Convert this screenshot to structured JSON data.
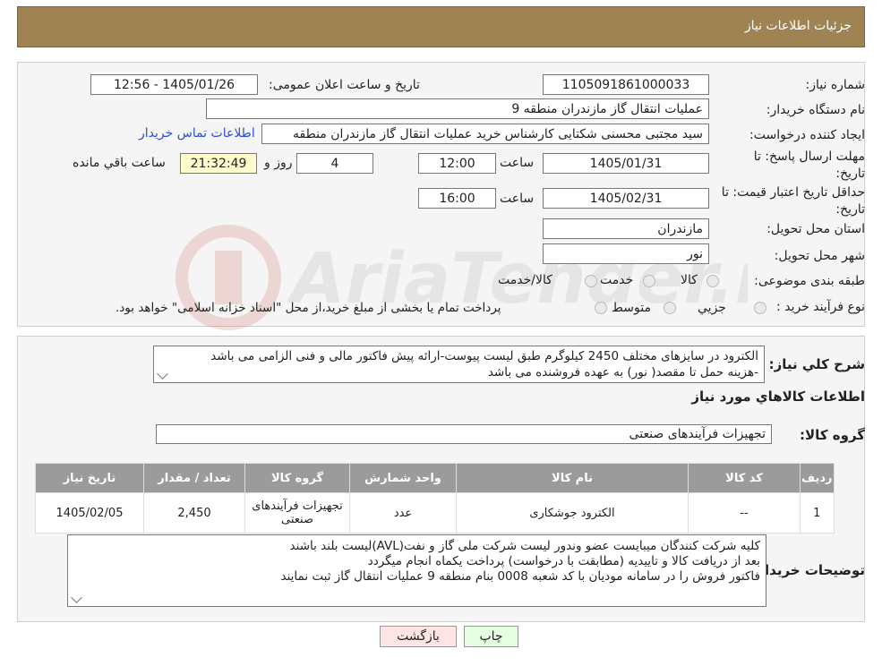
{
  "header": {
    "title": "جزئیات اطلاعات نیاز"
  },
  "details": {
    "need_number_label": "شماره نیاز:",
    "need_number": "1105091861000033",
    "announce_label": "تاریخ و ساعت اعلان عمومی:",
    "announce_value": "1405/01/26 - 12:56",
    "buyer_org_label": "نام دستگاه خریدار:",
    "buyer_org": "عملیات انتقال گاز مازندران منطقه 9",
    "creator_label": "ایجاد کننده درخواست:",
    "creator": "سید مجتبی محسنی شکتایی کارشناس خرید عملیات انتقال گاز مازندران منطقه",
    "contact_link": "اطلاعات تماس خریدار",
    "deadline_label": "مهلت ارسال پاسخ: تا تاریخ:",
    "deadline_date": "1405/01/31",
    "time_label": "ساعت",
    "deadline_time": "12:00",
    "days_value": "4",
    "days_label": "روز و",
    "remaining_time": "21:32:49",
    "remaining_label": "ساعت باقي مانده",
    "validity_label": "حداقل تاریخ اعتبار قیمت: تا تاریخ:",
    "validity_date": "1405/02/31",
    "validity_time": "16:00",
    "province_label": "استان محل تحویل:",
    "province": "مازندران",
    "city_label": "شهر محل تحویل:",
    "city": "نور",
    "category_label": "طبقه بندی موضوعی:",
    "category_options": [
      "کالا",
      "خدمت",
      "کالا/خدمت"
    ],
    "process_label": "نوع فرآیند خرید :",
    "process_options": [
      "جزیي",
      "متوسط"
    ],
    "process_note": "پرداخت تمام یا بخشی از مبلغ خرید،از محل \"اسناد خزانه اسلامی\" خواهد بود."
  },
  "summary": {
    "label": "شرح كلي نياز:",
    "text_line1": "الکترود در سایزهای مختلف 2450 کیلوگرم طبق لیست پیوست-ارائه پیش فاکتور مالی و فنی الزامی می باشد",
    "text_line2": "-هزینه حمل تا مقصد( نور) به عهده فروشنده می باشد",
    "goods_info_title": "اطلاعات كالاهاي مورد نياز",
    "group_label": "گروه كالا:",
    "group_value": "تجهیزات فرآیندهای صنعتی"
  },
  "table": {
    "headers": [
      "رديف",
      "كد كالا",
      "نام كالا",
      "واحد شمارش",
      "گروه كالا",
      "تعداد / مقدار",
      "تاریخ نیاز"
    ],
    "rows": [
      [
        "1",
        "--",
        "الکترود جوشکاری",
        "عدد",
        "تجهیزات فرآیندهای صنعتی",
        "2,450",
        "1405/02/05"
      ]
    ]
  },
  "buyer_notes": {
    "label": "توضيحات خريدار:",
    "line1": "کلیه شرکت کنندگان میبایست عضو وندور لیست شرکت ملی گاز و نفت(AVL)لیست بلند باشند",
    "line2": "بعد از دریافت کالا و تاییدیه (مطابقت با درخواست) پرداخت یکماه انجام میگردد",
    "line3": "فاکتور فروش را در سامانه مودیان با کد شعبه 0008 بنام منطقه 9 عملیات انتقال گاز ثبت نمایند"
  },
  "buttons": {
    "print": "چاپ",
    "back": "بازگشت"
  },
  "colors": {
    "header_bg": "#a08353",
    "back_bg": "#ffe4e4",
    "print_bg": "#e6ffe0",
    "table_head": "#9b9b9b"
  }
}
